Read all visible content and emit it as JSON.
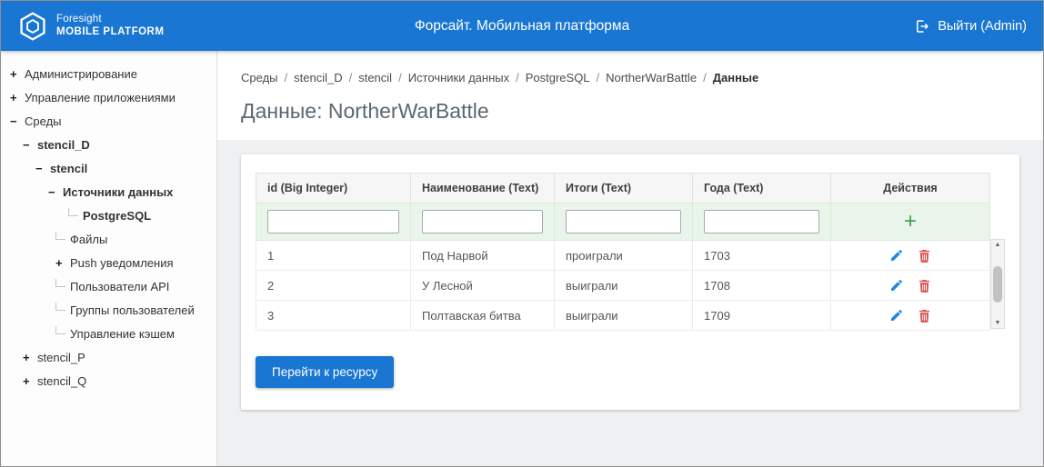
{
  "header": {
    "brand": {
      "line1": "Foresight",
      "line2": "MOBILE PLATFORM"
    },
    "title": "Форсайт. Мобильная платформа",
    "logout": {
      "label": "Выйти (Admin)"
    }
  },
  "sidebar": {
    "items": [
      {
        "label": "Администрирование",
        "toggle": "+"
      },
      {
        "label": "Управление приложениями",
        "toggle": "+"
      },
      {
        "label": "Среды",
        "toggle": "−"
      },
      {
        "label": "stencil_D",
        "toggle": "−"
      },
      {
        "label": "stencil",
        "toggle": "−"
      },
      {
        "label": "Источники данных",
        "toggle": "−"
      },
      {
        "label": "PostgreSQL",
        "toggle": ""
      },
      {
        "label": "Файлы",
        "toggle": ""
      },
      {
        "label": "Push уведомления",
        "toggle": "+"
      },
      {
        "label": "Пользователи API",
        "toggle": ""
      },
      {
        "label": "Группы пользователей",
        "toggle": ""
      },
      {
        "label": "Управление кэшем",
        "toggle": ""
      },
      {
        "label": "stencil_P",
        "toggle": "+"
      },
      {
        "label": "stencil_Q",
        "toggle": "+"
      }
    ]
  },
  "breadcrumb": {
    "separator": "/",
    "items": [
      "Среды",
      "stencil_D",
      "stencil",
      "Источники данных",
      "PostgreSQL",
      "NortherWarBattle",
      "Данные"
    ]
  },
  "page": {
    "title": "Данные: NortherWarBattle"
  },
  "datatable": {
    "headers": [
      "id (Big Integer)",
      "Наименование (Text)",
      "Итоги (Text)",
      "Года (Text)",
      "Действия"
    ],
    "add_icon": "+",
    "rows": [
      {
        "cells": [
          "1",
          "Под Нарвой",
          "проиграли",
          "1703"
        ]
      },
      {
        "cells": [
          "2",
          "У Лесной",
          "выиграли",
          "1708"
        ]
      },
      {
        "cells": [
          "3",
          "Полтавская битва",
          "выиграли",
          "1709"
        ]
      }
    ]
  },
  "scrollbar": {
    "up": "▲",
    "down": "▼"
  },
  "footer": {
    "go_button_label": "Перейти к ресурсу"
  },
  "colors": {
    "header_bg": "#1976d2",
    "primary_button": "#1976d2",
    "filter_row_bg": "#e9f5ea",
    "add_icon": "#43a047",
    "edit_icon": "#1e88e5",
    "delete_icon": "#d9534f"
  }
}
